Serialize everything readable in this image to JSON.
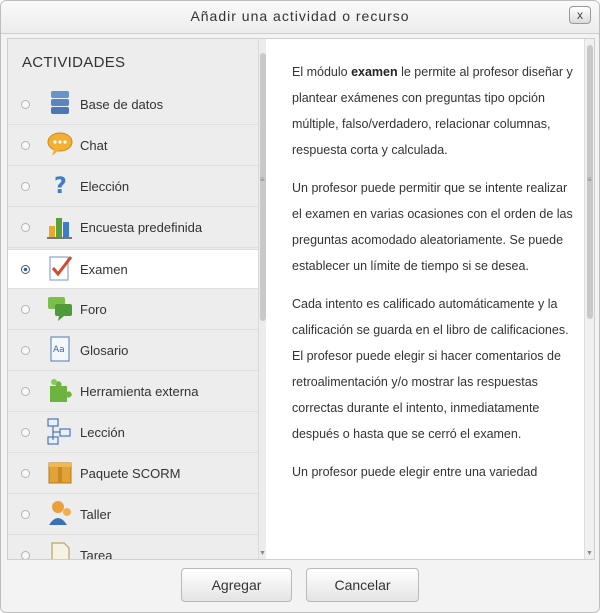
{
  "dialog": {
    "title": "Añadir una actividad o recurso",
    "close_label": "x"
  },
  "activities": {
    "heading": "ACTIVIDADES",
    "items": [
      {
        "label": "Base de datos",
        "icon": "database-icon",
        "selected": false
      },
      {
        "label": "Chat",
        "icon": "chat-bubble-icon",
        "selected": false
      },
      {
        "label": "Elección",
        "icon": "question-mark-icon",
        "selected": false
      },
      {
        "label": "Encuesta predefinida",
        "icon": "bar-chart-icon",
        "selected": false
      },
      {
        "label": "Examen",
        "icon": "checkmark-paper-icon",
        "selected": true
      },
      {
        "label": "Foro",
        "icon": "forum-bubbles-icon",
        "selected": false
      },
      {
        "label": "Glosario",
        "icon": "glossary-book-icon",
        "selected": false
      },
      {
        "label": "Herramienta externa",
        "icon": "puzzle-piece-icon",
        "selected": false
      },
      {
        "label": "Lección",
        "icon": "flowchart-icon",
        "selected": false
      },
      {
        "label": "Paquete SCORM",
        "icon": "package-box-icon",
        "selected": false
      },
      {
        "label": "Taller",
        "icon": "people-icon",
        "selected": false
      },
      {
        "label": "Tarea",
        "icon": "document-icon",
        "selected": false
      }
    ]
  },
  "description": {
    "p1_before": "El módulo ",
    "p1_bold": "examen",
    "p1_after": " le permite al profesor diseñar y plantear exámenes con preguntas tipo opción múltiple, falso/verdadero, relacionar columnas, respuesta corta y calculada.",
    "p2": "Un profesor puede permitir que se intente realizar el examen en varias ocasiones con el orden de las preguntas acomodado aleatoriamente. Se puede establecer un límite de tiempo si se desea.",
    "p3": "Cada intento es calificado automáticamente y la calificación se guarda en el libro de calificaciones. El profesor puede elegir si hacer comentarios de retroalimentación y/o mostrar las respuestas correctas durante el intento, inmediatamente después o hasta que se cerró el examen.",
    "p4": "Un profesor puede elegir entre una variedad"
  },
  "footer": {
    "add_label": "Agregar",
    "cancel_label": "Cancelar"
  }
}
